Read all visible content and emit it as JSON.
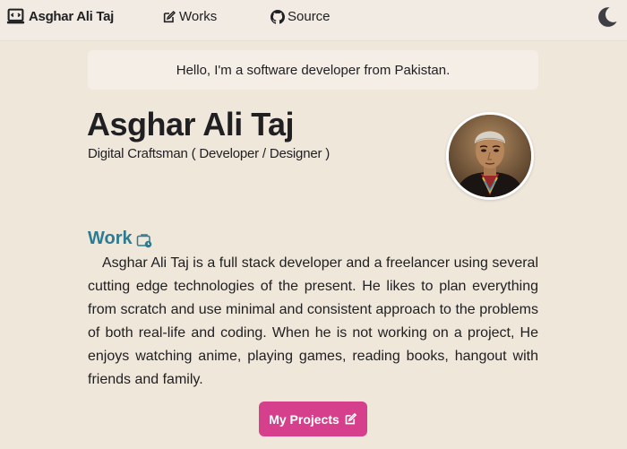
{
  "nav": {
    "brand": "Asghar Ali Taj",
    "links": [
      {
        "label": "Works",
        "icon": "edit-icon"
      },
      {
        "label": "Source",
        "icon": "github-icon"
      }
    ],
    "theme_toggle_icon": "moon-icon"
  },
  "hero": {
    "greeting": "Hello, I'm a software developer from Pakistan.",
    "name": "Asghar Ali Taj",
    "subtitle": "Digital Craftsman ( Developer / Designer )"
  },
  "work": {
    "heading": "Work",
    "heading_icon": "briefcase-clock-icon",
    "paragraph": "Asghar Ali Taj is a full stack developer and a freelancer using several cutting edge technologies of the present. He likes to plan everything from scratch and use minimal and consistent approach to the problems of both real-life and coding. When he is not working on a project, He enjoys watching anime, playing games, reading books, hangout with friends and family.",
    "button_label": "My Projects",
    "button_icon": "edit-icon"
  },
  "colors": {
    "background": "#f0e7db",
    "accent_heading": "#2b7c93",
    "button": "#d53f8c",
    "text": "#202023"
  }
}
